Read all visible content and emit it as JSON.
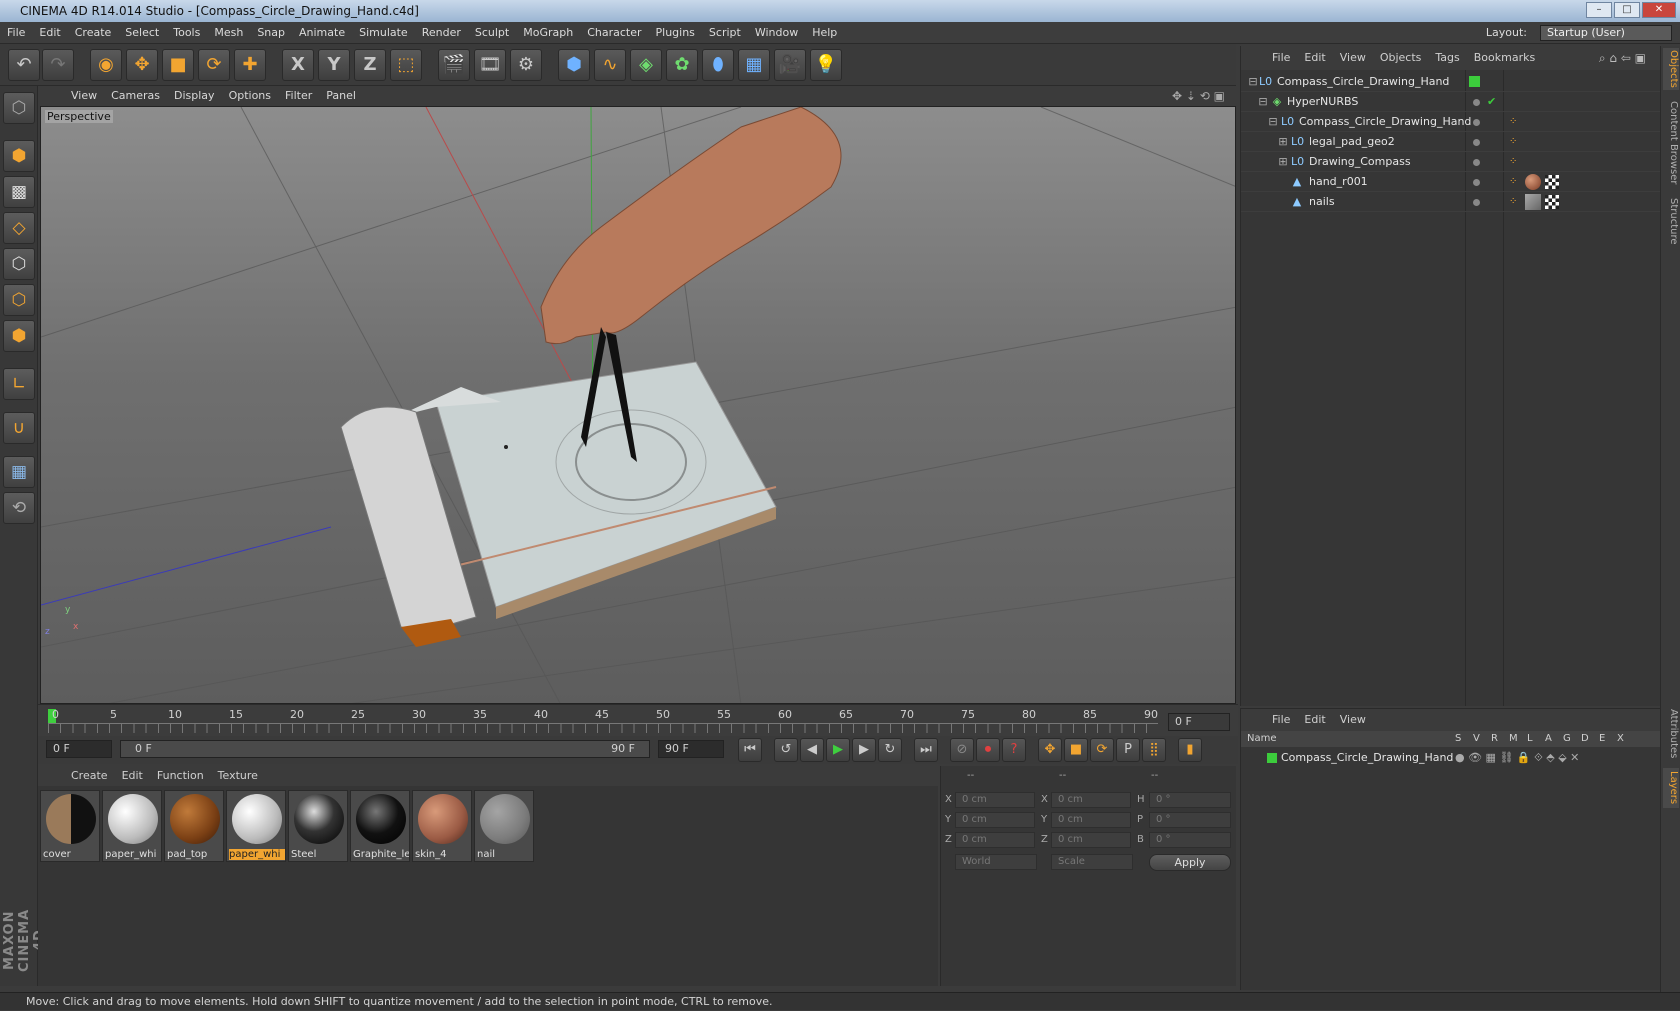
{
  "window": {
    "title": "CINEMA 4D R14.014 Studio - [Compass_Circle_Drawing_Hand.c4d]"
  },
  "menubar": {
    "items": [
      "File",
      "Edit",
      "Create",
      "Select",
      "Tools",
      "Mesh",
      "Snap",
      "Animate",
      "Simulate",
      "Render",
      "Sculpt",
      "MoGraph",
      "Character",
      "Plugins",
      "Script",
      "Window",
      "Help"
    ],
    "layout_label": "Layout:",
    "layout_value": "Startup (User)"
  },
  "toolbar": {
    "axis_x": "X",
    "axis_y": "Y",
    "axis_z": "Z"
  },
  "viewport": {
    "menu": [
      "View",
      "Cameras",
      "Display",
      "Options",
      "Filter",
      "Panel"
    ],
    "label": "Perspective",
    "axis_labels": {
      "x": "x",
      "y": "y",
      "z": "z"
    }
  },
  "timeline": {
    "ticks": [
      "0",
      "5",
      "10",
      "15",
      "20",
      "25",
      "30",
      "35",
      "40",
      "45",
      "50",
      "55",
      "60",
      "65",
      "70",
      "75",
      "80",
      "85",
      "90"
    ],
    "current_frame": "0 F",
    "start_frame": "0 F",
    "range_start": "0 F",
    "range_end": "90 F",
    "end_frame": "90 F"
  },
  "materials": {
    "menu": [
      "Create",
      "Edit",
      "Function",
      "Texture"
    ],
    "items": [
      {
        "name": "cover",
        "color": "#8a6a4a"
      },
      {
        "name": "paper_whi",
        "color": "#d8d8d8"
      },
      {
        "name": "pad_top",
        "color": "#8a4a1e"
      },
      {
        "name": "paper_whi",
        "color": "#d8d8d8",
        "selected": true
      },
      {
        "name": "Steel",
        "color": "#2a2a2a"
      },
      {
        "name": "Graphite_le",
        "color": "#151515"
      },
      {
        "name": "skin_4",
        "color": "#a0604a"
      },
      {
        "name": "nail",
        "color": "#9a9a9a"
      }
    ]
  },
  "attributes": {
    "headers": [
      "--",
      "--",
      "--"
    ],
    "rows": [
      {
        "a": "X",
        "av": "0 cm",
        "b": "X",
        "bv": "0 cm",
        "c": "H",
        "cv": "0 °"
      },
      {
        "a": "Y",
        "av": "0 cm",
        "b": "Y",
        "bv": "0 cm",
        "c": "P",
        "cv": "0 °"
      },
      {
        "a": "Z",
        "av": "0 cm",
        "b": "Z",
        "bv": "0 cm",
        "c": "B",
        "cv": "0 °"
      }
    ],
    "coord_system": "World",
    "mode": "Scale",
    "apply_label": "Apply"
  },
  "objects": {
    "menu": [
      "File",
      "Edit",
      "View",
      "Objects",
      "Tags",
      "Bookmarks"
    ],
    "tree": [
      {
        "name": "Compass_Circle_Drawing_Hand",
        "indent": 0,
        "icon": "null-icon"
      },
      {
        "name": "HyperNURBS",
        "indent": 1,
        "icon": "hypernurbs-icon"
      },
      {
        "name": "Compass_Circle_Drawing_Hand",
        "indent": 2,
        "icon": "null-icon"
      },
      {
        "name": "legal_pad_geo2",
        "indent": 3,
        "icon": "null-icon"
      },
      {
        "name": "Drawing_Compass",
        "indent": 3,
        "icon": "null-icon"
      },
      {
        "name": "hand_r001",
        "indent": 3,
        "icon": "polygon-icon"
      },
      {
        "name": "nails",
        "indent": 3,
        "icon": "polygon-icon"
      }
    ]
  },
  "layers": {
    "menu": [
      "File",
      "Edit",
      "View"
    ],
    "columns": [
      "Name",
      "S",
      "V",
      "R",
      "M",
      "L",
      "A",
      "G",
      "D",
      "E",
      "X"
    ],
    "rows": [
      {
        "name": "Compass_Circle_Drawing_Hand",
        "color": "#3ccc3c"
      }
    ]
  },
  "right_tabs": [
    "Objects",
    "Content Browser",
    "Structure",
    "Attributes",
    "Layers"
  ],
  "brand": "MAXON CINEMA 4D",
  "statusbar": {
    "text": "Move: Click and drag to move elements. Hold down SHIFT to quantize movement / add to the selection in point mode, CTRL to remove."
  }
}
